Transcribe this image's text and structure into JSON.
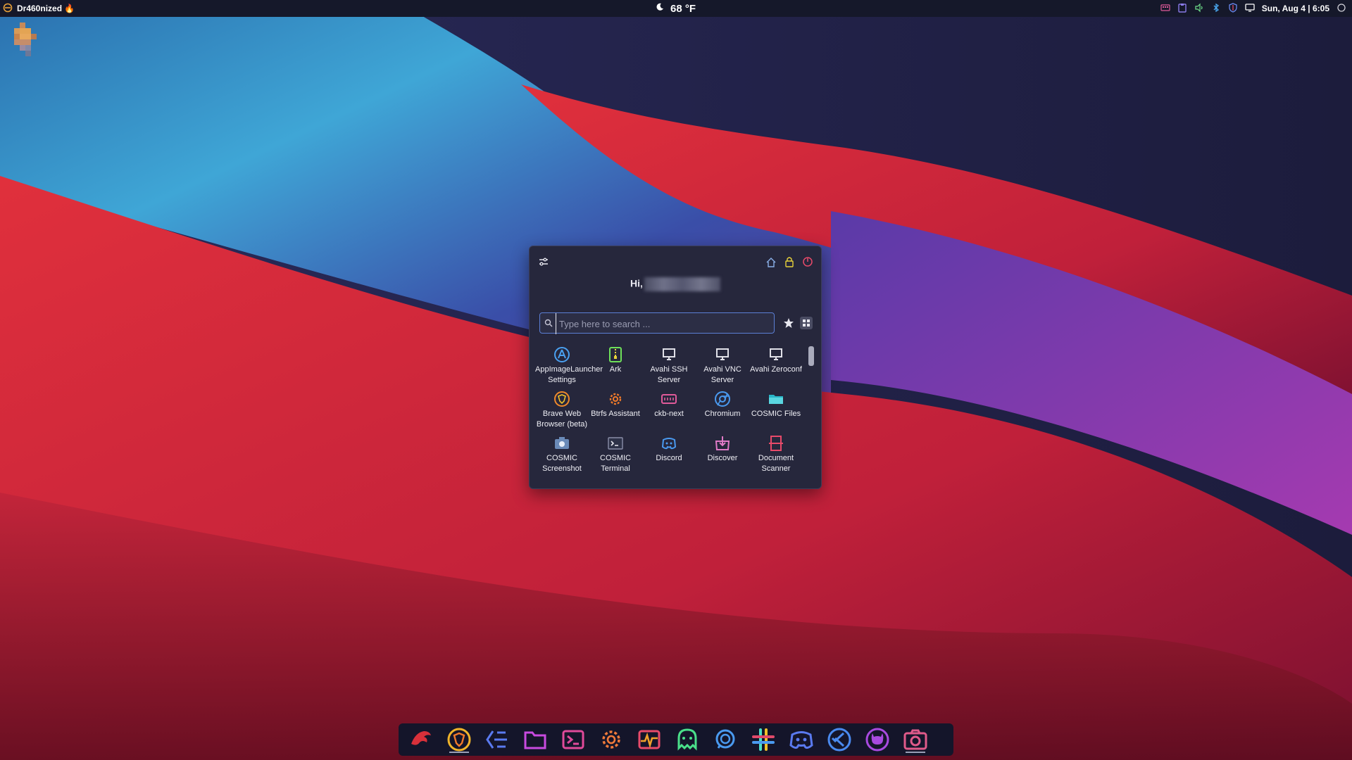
{
  "topbar": {
    "workspace_label": "Dr460nized 🔥",
    "weather": "68 °F",
    "clock": "Sun, Aug 4 | 6:05"
  },
  "launcher": {
    "greeting": "Hi,",
    "search_placeholder": "Type here to search ...",
    "apps": [
      {
        "label": "AppImageLauncher Settings",
        "icon": "appimage-icon"
      },
      {
        "label": "Ark",
        "icon": "archive-icon"
      },
      {
        "label": "Avahi SSH Server",
        "icon": "monitor-icon"
      },
      {
        "label": "Avahi VNC Server",
        "icon": "monitor-icon"
      },
      {
        "label": "Avahi Zeroconf",
        "icon": "monitor-icon"
      },
      {
        "label": "Brave Web Browser (beta)",
        "icon": "brave-icon"
      },
      {
        "label": "Btrfs Assistant",
        "icon": "gear-icon"
      },
      {
        "label": "ckb-next",
        "icon": "keyboard-icon"
      },
      {
        "label": "Chromium",
        "icon": "chromium-icon"
      },
      {
        "label": "COSMIC Files",
        "icon": "folder-icon"
      },
      {
        "label": "COSMIC Screenshot",
        "icon": "camera-icon"
      },
      {
        "label": "COSMIC Terminal",
        "icon": "terminal-icon"
      },
      {
        "label": "Discord",
        "icon": "discord-icon"
      },
      {
        "label": "Discover",
        "icon": "discover-icon"
      },
      {
        "label": "Document Scanner",
        "icon": "scanner-icon"
      }
    ]
  },
  "dock": {
    "items": [
      {
        "name": "garuda-dragon-icon"
      },
      {
        "name": "brave-browser-icon"
      },
      {
        "name": "editor-icon"
      },
      {
        "name": "files-icon"
      },
      {
        "name": "terminal-icon"
      },
      {
        "name": "settings-icon"
      },
      {
        "name": "system-monitor-icon"
      },
      {
        "name": "ghost-icon"
      },
      {
        "name": "chat-icon"
      },
      {
        "name": "slack-icon"
      },
      {
        "name": "discord-icon"
      },
      {
        "name": "vscode-icon"
      },
      {
        "name": "github-icon"
      },
      {
        "name": "screenshot-icon"
      }
    ]
  },
  "colors": {
    "accent": "#5b7fd6",
    "panel_bg": "#26273c",
    "topbar_bg": "#15182a",
    "dock_bg": "#14152a"
  }
}
